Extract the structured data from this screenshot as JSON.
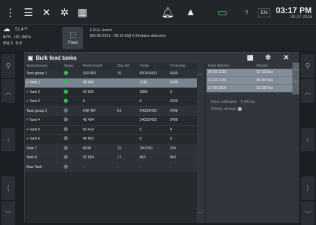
{
  "topbar": {
    "icons_left": [
      "menu-dots-icon",
      "sliders-icon",
      "tools-icon",
      "gear-icon",
      "grid-icon"
    ],
    "icons_mid": [
      "bell-icon",
      "warning-icon",
      "battery-icon"
    ],
    "help": "?",
    "lang": "EN",
    "time": "03:17 PM",
    "date": "30-07-2016"
  },
  "info": {
    "temp": "52.4°F",
    "humidity": "62%",
    "pressure": "101.3kPa",
    "wind_label": "3NLS",
    "wind_dir": "N 6",
    "feed_label": "Feed",
    "board_title": "EDGE board",
    "board_msg": "[08-06-2016 - 08:19 AM] 6 Modules detected"
  },
  "dialog": {
    "title": "Bulk feed tanks",
    "columns": [
      "Tanks/groups",
      "Status",
      "Feed weight",
      "Day left",
      "Today",
      "Yesterday"
    ],
    "rows": [
      {
        "name": "Tank group 1",
        "status": "on",
        "weight": "100 963",
        "days": "15",
        "today": "6001/6400",
        "yesterday": "6400",
        "style": "alt"
      },
      {
        "name": "+ Tank 1",
        "status": "on",
        "weight": "58 462",
        "days": "",
        "today": "3112",
        "yesterday": "3200",
        "style": "sel"
      },
      {
        "name": "+ Tank 2",
        "status": "on",
        "weight": "42 501",
        "days": "",
        "today": "2889",
        "yesterday": "0",
        "style": ""
      },
      {
        "name": "+ Tank 3",
        "status": "on",
        "weight": "0",
        "days": "",
        "today": "0",
        "yesterday": "3200",
        "style": ""
      },
      {
        "name": "Tank group 2",
        "status": "off",
        "weight": "148 467",
        "days": "61",
        "today": "2400/2400",
        "yesterday": "2400",
        "style": "alt"
      },
      {
        "name": "+ Tank 4",
        "status": "off",
        "weight": "45 454",
        "days": "",
        "today": "2400/2400",
        "yesterday": "2400",
        "style": ""
      },
      {
        "name": "+ Tank 5",
        "status": "off",
        "weight": "50 412",
        "days": "",
        "today": "0",
        "yesterday": "0",
        "style": ""
      },
      {
        "name": "+ Tank 6",
        "status": "off",
        "weight": "49 601",
        "days": "",
        "today": "0",
        "yesterday": "0",
        "style": ""
      },
      {
        "name": "Tank 7",
        "status": "off",
        "weight": "8208",
        "days": "32",
        "today": "250/250",
        "yesterday": "250",
        "style": "alt"
      },
      {
        "name": "Tank 8",
        "status": "off",
        "weight": "15 654",
        "days": "17",
        "today": "863",
        "yesterday": "950",
        "style": "alt"
      },
      {
        "name": "New Tank",
        "status": "off",
        "weight": "-",
        "days": "-",
        "today": "-",
        "yesterday": "-",
        "style": "alt"
      }
    ]
  },
  "delivery": {
    "columns": [
      "Feed delivery",
      "Weight"
    ],
    "rows": [
      {
        "date": "09-09-2016",
        "weight": "52 159 lbs"
      },
      {
        "date": "10-03-2016",
        "weight": "48 863 lbs"
      },
      {
        "date": "11-08-2016",
        "weight": "51 236 lbs"
      }
    ],
    "order_label": "Order notification",
    "order_value": "5 000 lbs",
    "delivery_label": "Delivery anyway"
  }
}
